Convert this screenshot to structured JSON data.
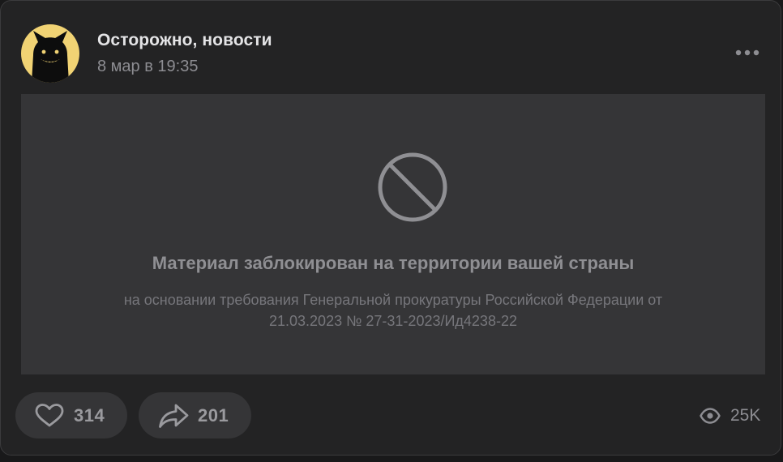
{
  "post": {
    "channel_name": "Осторожно, новости",
    "date": "8 мар в 19:35",
    "more_icon": "more-horizontal-icon",
    "avatar_icon": "black-cat-avatar"
  },
  "blocked": {
    "icon": "blocked-icon",
    "title": "Материал заблокирован на территории вашей страны",
    "subtitle": "на основании требования Генеральной прокуратуры Российской Федерации от 21.03.2023 № 27-31-2023/Ид4238-22"
  },
  "footer": {
    "likes": "314",
    "shares": "201",
    "views": "25K",
    "like_icon": "heart-icon",
    "share_icon": "share-arrow-icon",
    "views_icon": "eye-icon"
  },
  "colors": {
    "card_background": "#232324",
    "media_placeholder": "#353537",
    "avatar_background": "#f1d374",
    "text_primary": "#e4e4e6",
    "text_secondary": "#8d8d92"
  }
}
